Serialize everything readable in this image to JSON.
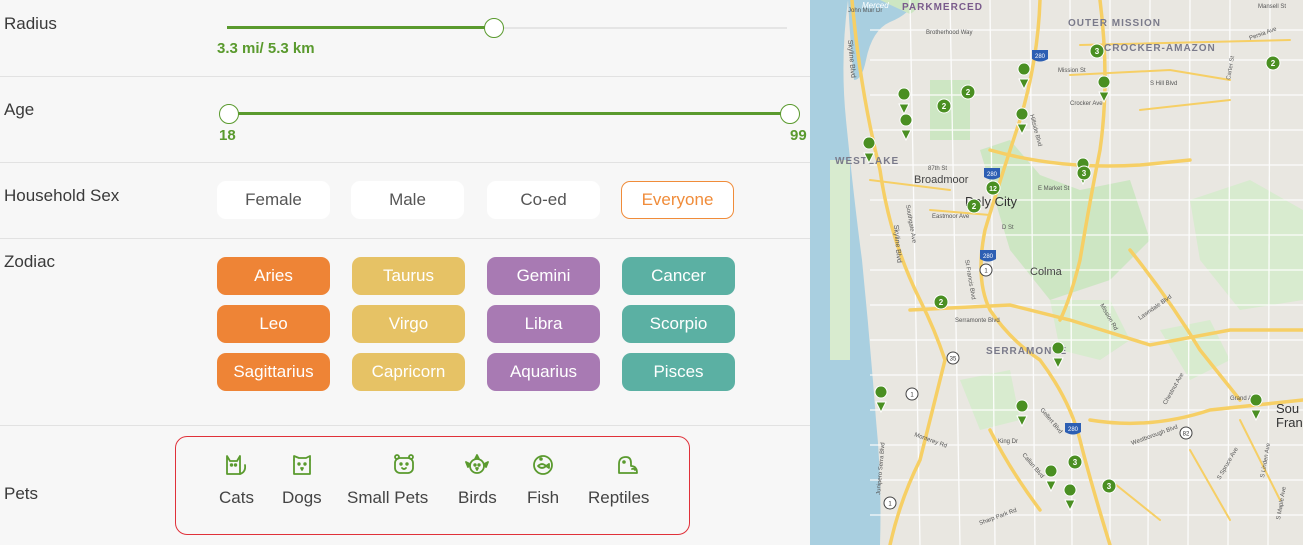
{
  "filters": {
    "radius": {
      "label": "Radius",
      "value": "3.3 mi/ 5.3 km",
      "fraction": 0.48
    },
    "age": {
      "label": "Age",
      "min": "18",
      "max": "99"
    },
    "household_sex": {
      "label": "Household Sex",
      "options": [
        "Female",
        "Male",
        "Co-ed",
        "Everyone"
      ],
      "selected": "Everyone"
    },
    "zodiac": {
      "label": "Zodiac",
      "signs": [
        "Aries",
        "Taurus",
        "Gemini",
        "Cancer",
        "Leo",
        "Virgo",
        "Libra",
        "Scorpio",
        "Sagittarius",
        "Capricorn",
        "Aquarius",
        "Pisces"
      ]
    },
    "pets": {
      "label": "Pets",
      "options": [
        {
          "label": "Cats",
          "icon": "cat-icon"
        },
        {
          "label": "Dogs",
          "icon": "dog-icon"
        },
        {
          "label": "Small Pets",
          "icon": "hamster-icon"
        },
        {
          "label": "Birds",
          "icon": "bird-icon"
        },
        {
          "label": "Fish",
          "icon": "fish-icon"
        },
        {
          "label": "Reptiles",
          "icon": "reptile-icon"
        }
      ]
    }
  },
  "colors": {
    "accent_green": "#5a9a2e",
    "selected_orange": "#f08c3a",
    "fire": "#ee8436",
    "earth": "#e6c265",
    "air": "#a87ab3",
    "water": "#5bb0a3",
    "highlight_red": "#e0313a"
  },
  "map": {
    "labels": {
      "parkmerced": "PARKMERCED",
      "outer_mission": "OUTER MISSION",
      "crocker_amazon": "CROCKER-AMAZON",
      "westlake": "WESTLAKE",
      "broadmoor": "Broadmoor",
      "daly_city": "Daly City",
      "colma": "Colma",
      "serramonte": "SERRAMONTE",
      "south_sf": "Sou",
      "south_sf2": "Fran",
      "skyline_blvd": "Skyline Blvd",
      "skyline_blvd2": "Skyline Blvd",
      "john_muir": "John Muir Dr",
      "brotherhood": "Brotherhood Way",
      "mission_st": "Mission St",
      "s_hill": "S Hill Blvd",
      "crocker_ave": "Crocker Ave",
      "hillside": "Hillside Blvd",
      "st87": "87th St",
      "e_market": "E Market St",
      "eastmoor": "Eastmoor Ave",
      "serramonte_blvd": "Serramonte Blvd",
      "mission_rd": "Mission Rd",
      "lawndale": "Lawndale Blvd",
      "grand_ave": "Grand Ave",
      "chestnut": "Chestnut Ave",
      "westborough": "Westborough Blvd",
      "king_dr": "King Dr",
      "callan": "Callan Blvd",
      "gellert": "Gellert Blvd",
      "monterey": "Monterey Rd",
      "sharp_park": "Sharp Park Rd",
      "spruce": "S Spruce Ave",
      "linden": "S Linden Ave",
      "maple": "S Maple Ave",
      "st_francis": "St Francis Blvd",
      "southgate": "Southgate Ave",
      "junipero": "Junipero Serra Blvd",
      "carter": "Carter St",
      "persia": "Persia Ave",
      "mansell": "Mansell St",
      "merced": "Merced",
      "ds": "D St"
    },
    "shields": [
      "280",
      "280",
      "280",
      "280",
      "1",
      "35",
      "1",
      "82",
      "1"
    ],
    "cluster_counts": [
      "3",
      "2",
      "2",
      "2",
      "3",
      "12",
      "2",
      "2",
      "3",
      "3"
    ]
  }
}
